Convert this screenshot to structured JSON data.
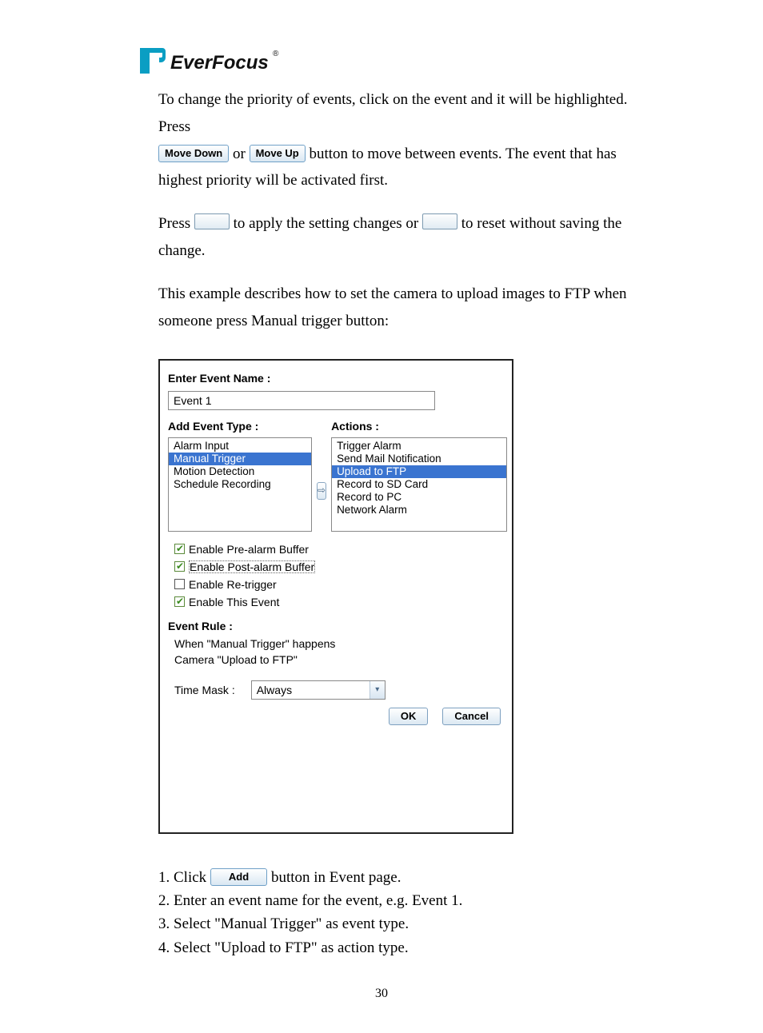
{
  "logo": {
    "brand": "EverFocus",
    "trademark": "®"
  },
  "para1_a": "To change the priority of events, click on the event and it will be highlighted. Press",
  "btn_move_down": "Move Down",
  "or": " or ",
  "btn_move_up": "Move Up",
  "para1_b": " button to move between events. The event that has highest priority will be activated first.",
  "para2_a": "Press ",
  "para2_b": " to apply the setting changes or ",
  "para2_c": " to reset without saving the change.",
  "para3": "This example describes how to set the camera to upload images to FTP when someone press Manual trigger button:",
  "dialog": {
    "enter_event_name": "Enter Event Name :",
    "event_name_value": "Event 1",
    "add_event_type": "Add Event Type :",
    "actions_label": "Actions :",
    "event_types": [
      "Alarm Input",
      "Manual Trigger",
      "Motion Detection",
      "Schedule Recording"
    ],
    "selected_event_type_index": 1,
    "actions": [
      "Trigger Alarm",
      "Send Mail Notification",
      "Upload to FTP",
      "Record to SD Card",
      "Record to PC",
      "Network Alarm"
    ],
    "selected_action_index": 2,
    "cb_pre": "Enable Pre-alarm Buffer",
    "cb_post": "Enable Post-alarm Buffer",
    "cb_retrigger": "Enable Re-trigger",
    "cb_this": "Enable This Event",
    "event_rule_label": "Event Rule :",
    "rule_line1": "When \"Manual Trigger\" happens",
    "rule_line2": "Camera \"Upload to FTP\"",
    "time_mask_label": "Time Mask :",
    "time_mask_value": "Always",
    "ok": "OK",
    "cancel": "Cancel"
  },
  "btn_add": "Add",
  "steps": {
    "s1a": "1. Click ",
    "s1b": " button in Event page.",
    "s2": "2. Enter an event name for the event, e.g. Event 1.",
    "s3": "3. Select \"Manual Trigger\" as event type.",
    "s4": "4. Select \"Upload to FTP\" as action type."
  },
  "page_number": "30"
}
